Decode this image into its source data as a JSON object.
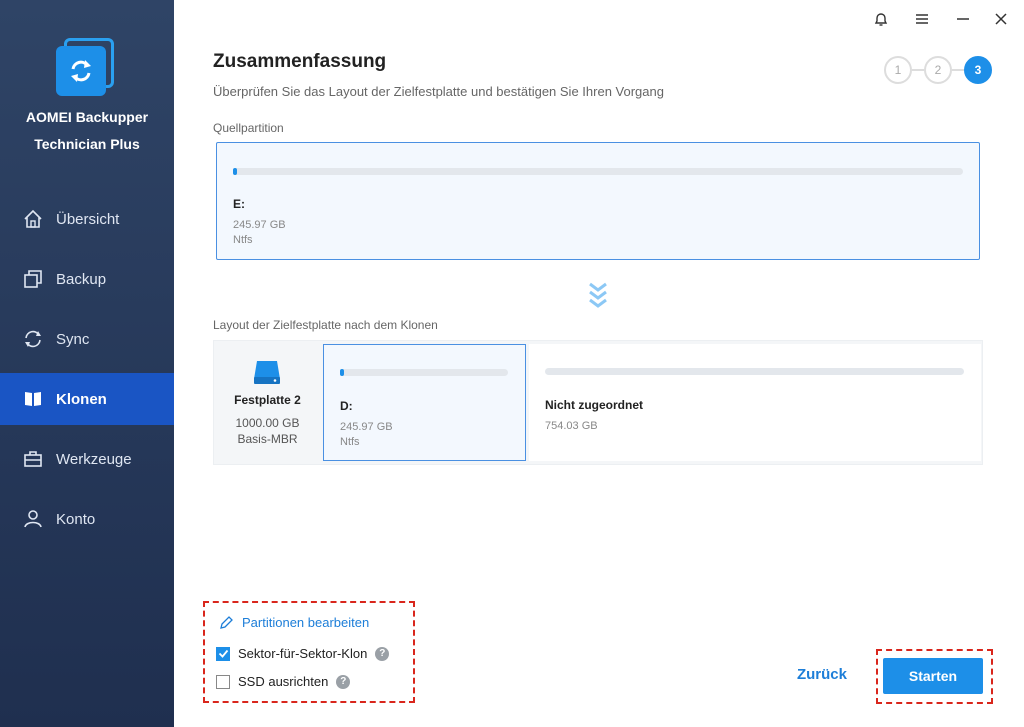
{
  "app": {
    "brand_line1": "AOMEI Backupper",
    "brand_line2": "Technician Plus"
  },
  "sidebar": {
    "items": [
      {
        "label": "Übersicht",
        "icon": "home-icon"
      },
      {
        "label": "Backup",
        "icon": "backup-icon"
      },
      {
        "label": "Sync",
        "icon": "sync-icon"
      },
      {
        "label": "Klonen",
        "icon": "clone-icon",
        "active": true
      },
      {
        "label": "Werkzeuge",
        "icon": "toolbox-icon"
      },
      {
        "label": "Konto",
        "icon": "user-icon"
      }
    ]
  },
  "header": {
    "title": "Zusammenfassung",
    "subtitle": "Überprüfen Sie das Layout der Zielfestplatte und bestätigen Sie Ihren Vorgang",
    "steps": [
      "1",
      "2",
      "3"
    ],
    "active_step": 3
  },
  "source": {
    "label": "Quellpartition",
    "partition": {
      "name": "E:",
      "size": "245.97 GB",
      "fs": "Ntfs"
    }
  },
  "destination": {
    "label": "Layout der Zielfestplatte nach dem Klonen",
    "disk": {
      "name": "Festplatte 2",
      "size": "1000.00 GB",
      "type": "Basis-MBR"
    },
    "partition": {
      "name": "D:",
      "size": "245.97 GB",
      "fs": "Ntfs"
    },
    "unallocated": {
      "name": "Nicht zugeordnet",
      "size": "754.03 GB"
    }
  },
  "options": {
    "edit_partitions": "Partitionen bearbeiten",
    "sector_clone": {
      "label": "Sektor-für-Sektor-Klon",
      "checked": true
    },
    "ssd_align": {
      "label": "SSD ausrichten",
      "checked": false
    },
    "help_glyph": "?"
  },
  "buttons": {
    "back": "Zurück",
    "start": "Starten"
  },
  "colors": {
    "accent": "#1d8fe8",
    "sidebar_active": "#1a55c4",
    "highlight_dash": "#d9261c"
  }
}
